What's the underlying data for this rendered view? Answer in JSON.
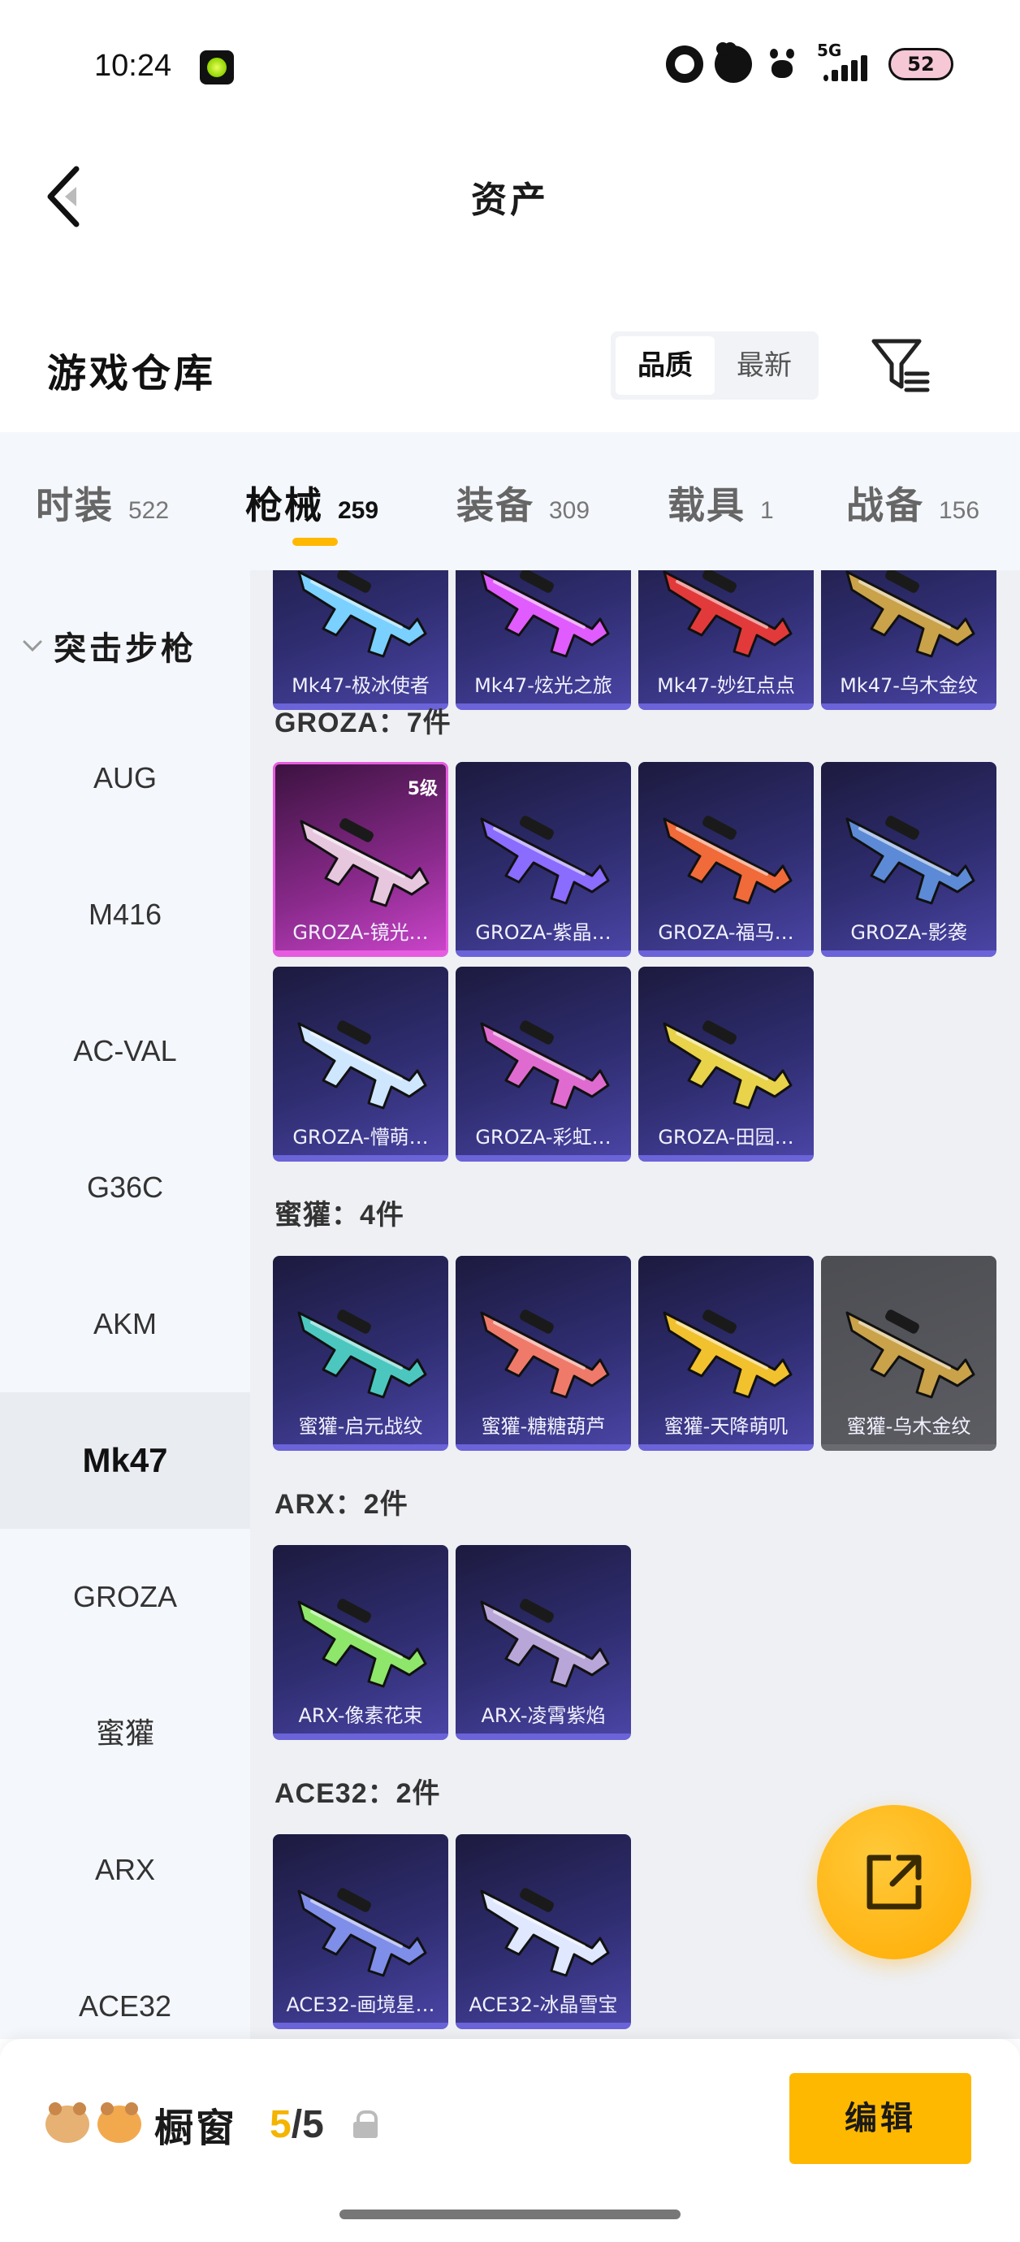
{
  "status": {
    "time": "10:24",
    "network": "5G",
    "battery": "52"
  },
  "header": {
    "title": "资产"
  },
  "section": {
    "title": "游戏仓库",
    "sort_options": [
      "品质",
      "最新"
    ],
    "sort_active": "品质"
  },
  "tabs": [
    {
      "label": "时装",
      "count": "522"
    },
    {
      "label": "枪械",
      "count": "259"
    },
    {
      "label": "装备",
      "count": "309"
    },
    {
      "label": "载具",
      "count": "1"
    },
    {
      "label": "战备",
      "count": "156"
    }
  ],
  "active_tab": "枪械",
  "sidebar": {
    "group": "突击步枪",
    "items": [
      {
        "label": "AUG"
      },
      {
        "label": "M416"
      },
      {
        "label": "AC-VAL"
      },
      {
        "label": "G36C"
      },
      {
        "label": "AKM"
      },
      {
        "label": "Mk47"
      },
      {
        "label": "GROZA"
      },
      {
        "label": "蜜獾"
      },
      {
        "label": "ARX"
      },
      {
        "label": "ACE32"
      }
    ],
    "active": "Mk47"
  },
  "groups": [
    {
      "title": "",
      "items": [
        {
          "name": "Mk47-极冰使者",
          "level": "",
          "color": "#7ad0ff"
        },
        {
          "name": "Mk47-炫光之旅",
          "level": "",
          "color": "#e05cff"
        },
        {
          "name": "Mk47-妙红点点",
          "level": "",
          "color": "#e23a3a"
        },
        {
          "name": "Mk47-乌木金纹",
          "level": "",
          "color": "#c9a24a"
        }
      ]
    },
    {
      "title": "GROZA：7件",
      "items": [
        {
          "name": "GROZA-镜光…",
          "level": "5级",
          "color": "#e7c7de",
          "rarity": "legend"
        },
        {
          "name": "GROZA-紫晶…",
          "level": "",
          "color": "#8a6cff"
        },
        {
          "name": "GROZA-福马…",
          "level": "",
          "color": "#f06a3a"
        },
        {
          "name": "GROZA-影袭",
          "level": "",
          "color": "#5c8ad6"
        },
        {
          "name": "GROZA-懵萌…",
          "level": "",
          "color": "#cfe6ff"
        },
        {
          "name": "GROZA-彩虹…",
          "level": "",
          "color": "#e06bd0"
        },
        {
          "name": "GROZA-田园…",
          "level": "",
          "color": "#e8d34a"
        }
      ]
    },
    {
      "title": "蜜獾：4件",
      "items": [
        {
          "name": "蜜獾-启元战纹",
          "level": "",
          "color": "#4cc7c0"
        },
        {
          "name": "蜜獾-糖糖葫芦",
          "level": "",
          "color": "#f07a6a"
        },
        {
          "name": "蜜獾-天降萌叽",
          "level": "",
          "color": "#f2c12e"
        },
        {
          "name": "蜜獾-乌木金纹",
          "level": "",
          "color": "#c9a24a",
          "rarity": "gray"
        }
      ]
    },
    {
      "title": "ARX：2件",
      "items": [
        {
          "name": "ARX-像素花束",
          "level": "",
          "color": "#8ee66a"
        },
        {
          "name": "ARX-凌霄紫焰",
          "level": "",
          "color": "#b9a6d8"
        }
      ]
    },
    {
      "title": "ACE32：2件",
      "items": [
        {
          "name": "ACE32-画境星…",
          "level": "",
          "color": "#7f8ee8"
        },
        {
          "name": "ACE32-冰晶雪宝",
          "level": "",
          "color": "#dfe8ff"
        }
      ]
    }
  ],
  "bottom": {
    "window_label": "橱窗",
    "count_current": "5",
    "count_sep": "/",
    "count_max": "5",
    "edit_label": "编辑"
  },
  "colors": {
    "accent": "#ffb800",
    "card_bg": "#2f2d70",
    "legend": "#c944c9"
  }
}
